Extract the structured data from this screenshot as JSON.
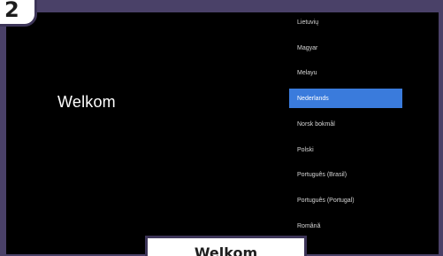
{
  "step": {
    "number": "2"
  },
  "screen": {
    "welcome_text": "Welkom",
    "languages": [
      {
        "label": "Lietuvių",
        "selected": false
      },
      {
        "label": "Magyar",
        "selected": false
      },
      {
        "label": "Melayu",
        "selected": false
      },
      {
        "label": "Nederlands",
        "selected": true
      },
      {
        "label": "Norsk bokmål",
        "selected": false
      },
      {
        "label": "Polski",
        "selected": false
      },
      {
        "label": "Português (Brasil)",
        "selected": false
      },
      {
        "label": "Português (Portugal)",
        "selected": false
      },
      {
        "label": "Română",
        "selected": false
      }
    ]
  },
  "caption": {
    "text": "Welkom"
  },
  "colors": {
    "border": "#4a4168",
    "selected_highlight": "#3a7bdc",
    "screen_background": "#000000"
  }
}
